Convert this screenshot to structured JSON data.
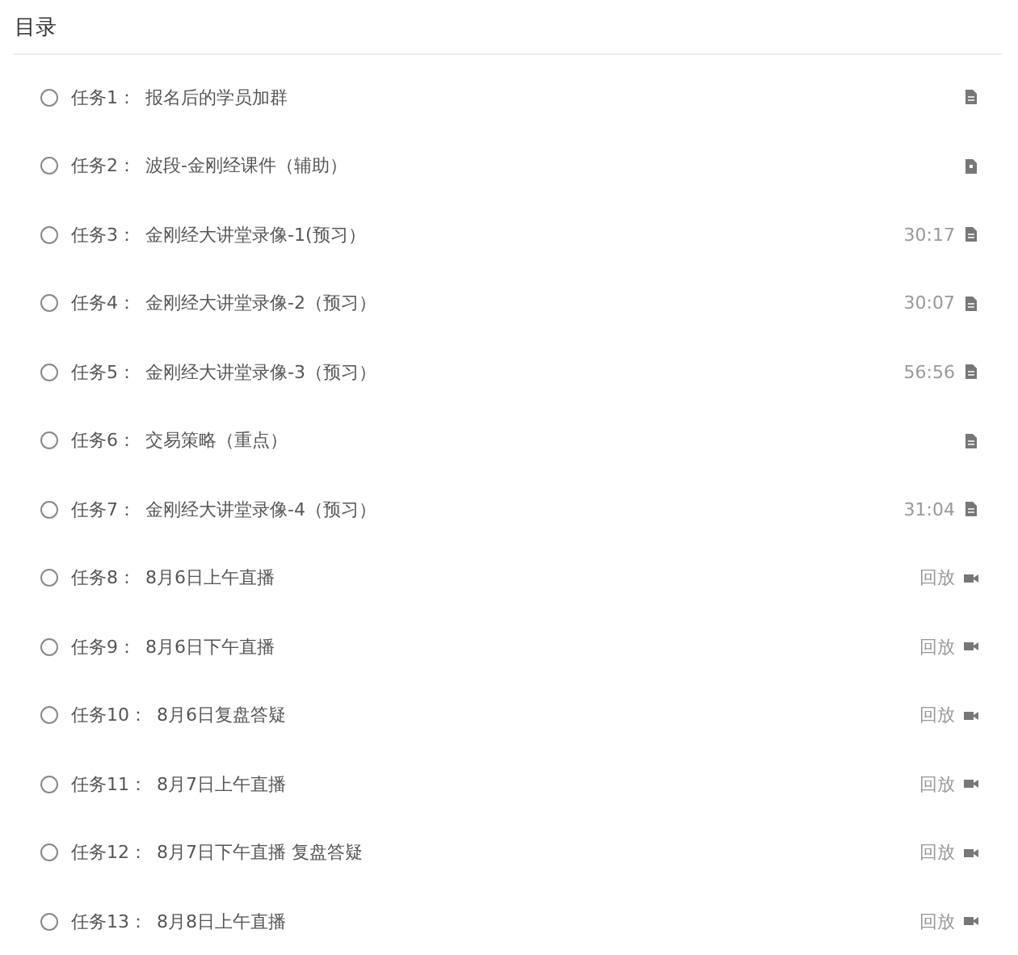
{
  "title": "目录",
  "tasks": [
    {
      "number": "任务1：",
      "title": "报名后的学员加群",
      "kind": "document"
    },
    {
      "number": "任务2：",
      "title": "波段-金刚经课件（辅助）",
      "kind": "slides"
    },
    {
      "number": "任务3：",
      "title": "金刚经大讲堂录像-1(预习）",
      "meta": "30:17",
      "kind": "document"
    },
    {
      "number": "任务4：",
      "title": "金刚经大讲堂录像-2（预习）",
      "meta": "30:07",
      "kind": "document"
    },
    {
      "number": "任务5：",
      "title": "金刚经大讲堂录像-3（预习）",
      "meta": "56:56",
      "kind": "document"
    },
    {
      "number": "任务6：",
      "title": "交易策略（重点）",
      "kind": "document"
    },
    {
      "number": "任务7：",
      "title": "金刚经大讲堂录像-4（预习）",
      "meta": "31:04",
      "kind": "document"
    },
    {
      "number": "任务8：",
      "title": "8月6日上午直播",
      "meta": "回放",
      "kind": "video"
    },
    {
      "number": "任务9：",
      "title": "8月6日下午直播",
      "meta": "回放",
      "kind": "video"
    },
    {
      "number": "任务10：",
      "title": "8月6日复盘答疑",
      "meta": "回放",
      "kind": "video"
    },
    {
      "number": "任务11：",
      "title": "8月7日上午直播",
      "meta": "回放",
      "kind": "video"
    },
    {
      "number": "任务12：",
      "title": "8月7日下午直播 复盘答疑",
      "meta": "回放",
      "kind": "video"
    },
    {
      "number": "任务13：",
      "title": "8月8日上午直播",
      "meta": "回放",
      "kind": "video"
    }
  ]
}
